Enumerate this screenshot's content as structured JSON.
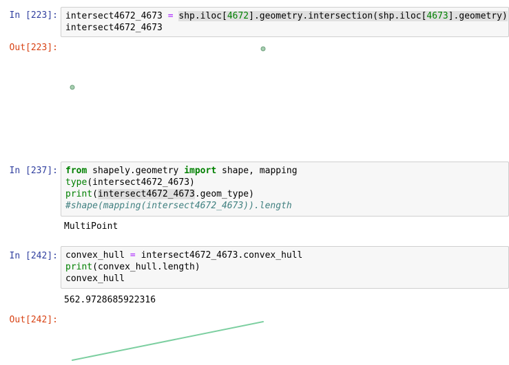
{
  "cells": [
    {
      "in_prompt": "In [223]:",
      "out_prompt": "Out[223]:",
      "lines": [
        [
          {
            "t": "intersect4672_4673 "
          },
          {
            "t": "=",
            "c": "op"
          },
          {
            "t": " "
          },
          {
            "t": "shp.iloc[",
            "c": "hl"
          },
          {
            "t": "4672",
            "c": "num hl"
          },
          {
            "t": "].geometry.intersection(shp.iloc[",
            "c": "hl"
          },
          {
            "t": "4673",
            "c": "num hl"
          },
          {
            "t": "].geometry)",
            "c": "hl"
          }
        ],
        [
          {
            "t": "intersect4672_4673"
          }
        ]
      ]
    },
    {
      "in_prompt": "In [237]:",
      "lines": [
        [
          {
            "t": "from",
            "c": "kw"
          },
          {
            "t": " shapely.geometry "
          },
          {
            "t": "import",
            "c": "kw"
          },
          {
            "t": " shape, mapping"
          }
        ],
        [
          {
            "t": "type",
            "c": "bi"
          },
          {
            "t": "(intersect4672_4673)"
          }
        ],
        [
          {
            "t": "print",
            "c": "bi"
          },
          {
            "t": "("
          },
          {
            "t": "intersect4672_4673",
            "c": "hl"
          },
          {
            "t": ".geom_type)"
          }
        ],
        [
          {
            "t": "#shape(mapping(intersect4672_4673)).length",
            "c": "cm"
          }
        ]
      ],
      "stdout": "MultiPoint"
    },
    {
      "in_prompt": "In [242]:",
      "out_prompt": "Out[242]:",
      "lines": [
        [
          {
            "t": "convex_hull "
          },
          {
            "t": "=",
            "c": "op"
          },
          {
            "t": " intersect4672_4673.convex_hull"
          }
        ],
        [
          {
            "t": "print",
            "c": "bi"
          },
          {
            "t": "(convex_hull.length)"
          }
        ],
        [
          {
            "t": "convex_hull"
          }
        ]
      ],
      "stdout": "562.9728685922316"
    }
  ],
  "colors": {
    "point_fill": "#a6cfb0",
    "point_stroke": "#6e9e7c",
    "line_stroke": "#7ccfa0"
  }
}
